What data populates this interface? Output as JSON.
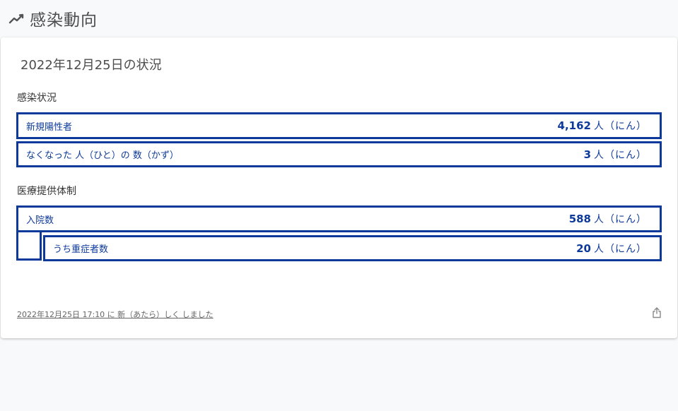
{
  "page": {
    "title": "感染動向",
    "title_icon": "trend-line-icon"
  },
  "card": {
    "date_heading": "2022年12月25日の状況",
    "infection": {
      "section_label": "感染状況",
      "rows": [
        {
          "label": "新規陽性者",
          "value": "4,162",
          "unit": "人（にん）"
        },
        {
          "label": "なくなった 人（ひと）の 数（かず）",
          "value": "3",
          "unit": "人（にん）"
        }
      ]
    },
    "medical": {
      "section_label": "医療提供体制",
      "hospitalized": {
        "label": "入院数",
        "value": "588",
        "unit": "人（にん）"
      },
      "severe": {
        "label": "うち重症者数",
        "value": "20",
        "unit": "人（にん）"
      }
    },
    "footer": {
      "updated_text": "2022年12月25日 17:10 に 新（あたら）しく しました",
      "share_icon": "share-icon"
    }
  },
  "colors": {
    "accent": "#0d3a9a",
    "background": "#f8f9fb",
    "card": "#ffffff"
  }
}
